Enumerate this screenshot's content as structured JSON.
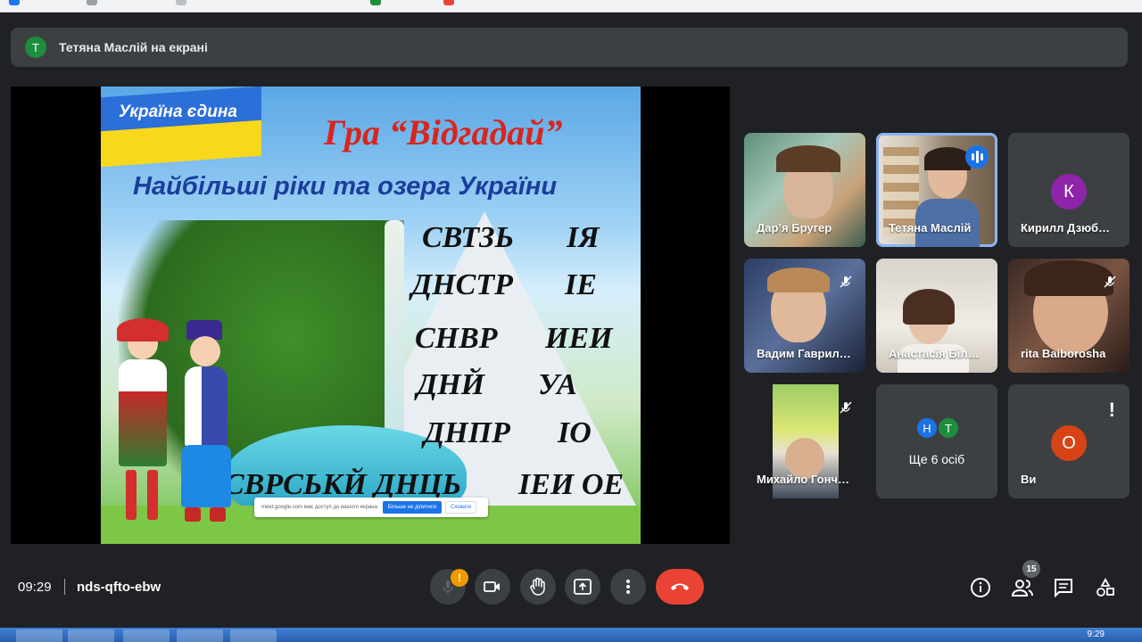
{
  "presenter": {
    "avatar_letter": "T",
    "text": "Тетяна Маслій на екрані"
  },
  "slide": {
    "flag_text": "Україна єдина",
    "title": "Гра “Відгадай”",
    "subtitle": "Найбільші ріки та озера України",
    "words": [
      {
        "consonants": "СВТЗЬ",
        "vowels": "ІЯ"
      },
      {
        "consonants": "ДНСТР",
        "vowels": "ІЕ"
      },
      {
        "consonants": "СНВР",
        "vowels": "ИЕИ"
      },
      {
        "consonants": "ДНЙ",
        "vowels": "УА"
      },
      {
        "consonants": "ДНПР",
        "vowels": "ІО"
      },
      {
        "consonants": "СВРСЬКЙ ДНЦЬ",
        "vowels": "ІЕИ ОЕ"
      }
    ],
    "share_banner": {
      "text": "meet.google.com має доступ до вашого екрана",
      "stop_label": "Більше не ділитися",
      "hide_label": "Сховати"
    }
  },
  "participants": [
    {
      "name": "Дар’я Бругер",
      "type": "video",
      "muted": false
    },
    {
      "name": "Тетяна Маслій",
      "type": "video",
      "speaking": true
    },
    {
      "name": "Кирилл Дзюб…",
      "type": "avatar",
      "letter": "К",
      "color": "#8e24aa"
    },
    {
      "name": "Вадим Гаврил…",
      "type": "video",
      "muted": true
    },
    {
      "name": "Анастасія Біл…",
      "type": "video",
      "muted": false
    },
    {
      "name": "rita Baiborosha",
      "type": "video",
      "muted": true
    },
    {
      "name": "Михайло Гонч…",
      "type": "video",
      "muted": true
    },
    {
      "name": "Ще 6 осіб",
      "type": "group",
      "letters": [
        "Н",
        "Т"
      ]
    },
    {
      "name": "Ви",
      "type": "avatar",
      "letter": "О",
      "color": "#d84315",
      "alert": "!"
    }
  ],
  "bottom_bar": {
    "time": "09:29",
    "meeting_code": "nds-qfto-ebw",
    "mic_warning": "!",
    "people_count": "15",
    "controls": [
      "mic-icon",
      "camera-icon",
      "raise-hand-icon",
      "present-icon",
      "more-icon",
      "end-call-icon"
    ],
    "right_icons": [
      "info-icon",
      "people-icon",
      "chat-icon",
      "activities-icon"
    ]
  },
  "taskbar": {
    "clock": "9:29"
  },
  "colors": {
    "background": "#202124",
    "tile": "#3c4043",
    "end_call": "#ea4335",
    "active_outline": "#8ab4f8",
    "warning": "#f29900"
  }
}
